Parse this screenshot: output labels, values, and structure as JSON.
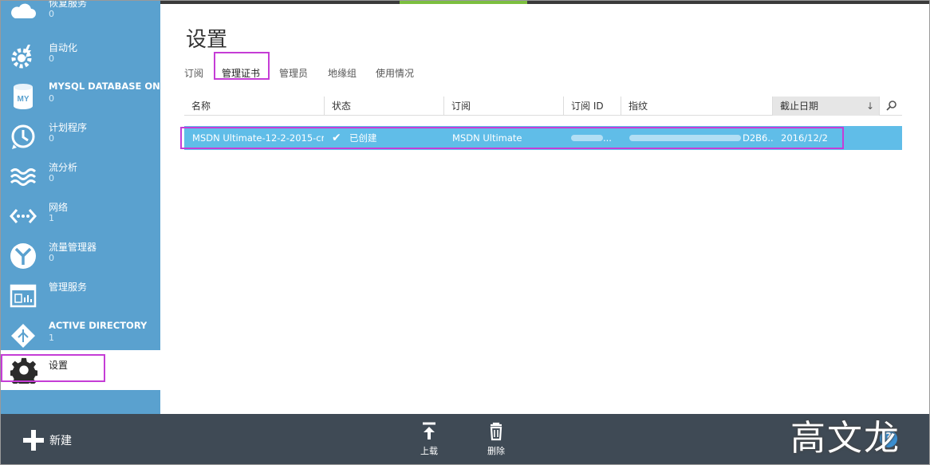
{
  "sidebar": {
    "items": [
      {
        "label": "恢复服务",
        "count": "0"
      },
      {
        "label": "自动化",
        "count": "0"
      },
      {
        "label": "MYSQL DATABASE ON ...",
        "count": "0"
      },
      {
        "label": "计划程序",
        "count": "0"
      },
      {
        "label": "流分析",
        "count": "0"
      },
      {
        "label": "网络",
        "count": "1"
      },
      {
        "label": "流量管理器",
        "count": "0"
      },
      {
        "label": "管理服务",
        "count": ""
      },
      {
        "label": "ACTIVE DIRECTORY",
        "count": "1"
      },
      {
        "label": "设置",
        "count": ""
      }
    ],
    "mysql_icon_text": "MY"
  },
  "main": {
    "title": "设置",
    "tabs": [
      "订阅",
      "管理证书",
      "管理员",
      "地缘组",
      "使用情况"
    ],
    "active_tab": "管理证书",
    "columns": [
      "名称",
      "状态",
      "订阅",
      "订阅 ID",
      "指纹",
      "截止日期"
    ],
    "sorted_column": "截止日期",
    "rows": [
      {
        "name": "MSDN Ultimate-12-2-2015-cr...",
        "status": "已创建",
        "subscription": "MSDN Ultimate",
        "subscription_id": "...",
        "thumbprint": "D2B6...",
        "expiry": "2016/12/2"
      }
    ]
  },
  "bottombar": {
    "new_label": "新建",
    "upload_label": "上载",
    "delete_label": "删除",
    "help": "?"
  },
  "watermark": "高文龙",
  "colors": {
    "sidebar": "#5aa1cf",
    "bottombar": "#3f4a55",
    "selected_row": "#60bde8",
    "highlight": "#c53dd6",
    "accent": "#7cbf3f"
  }
}
